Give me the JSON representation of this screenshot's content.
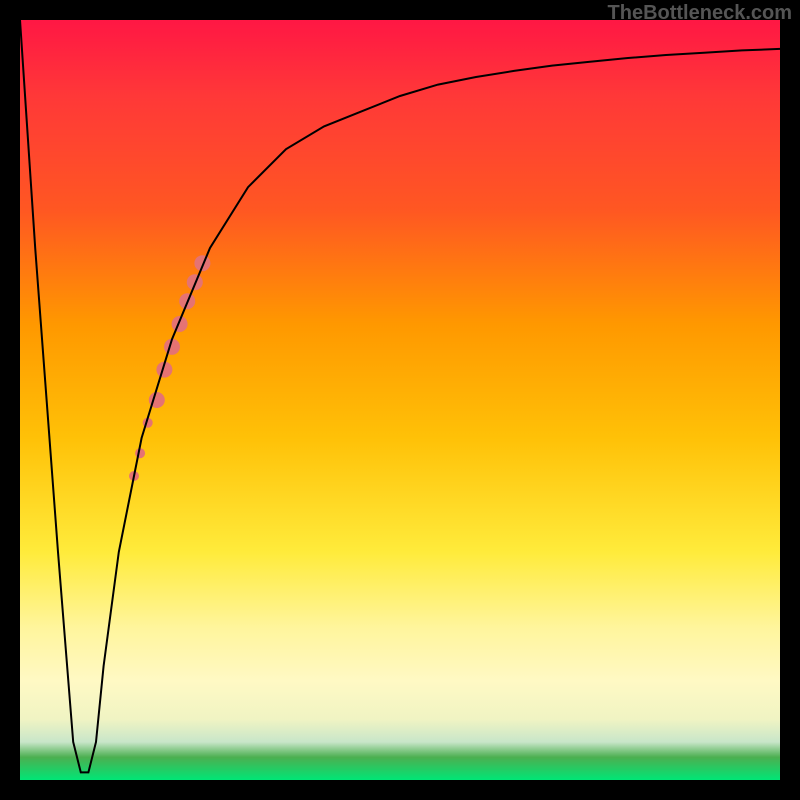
{
  "watermark": "TheBottleneck.com",
  "chart_data": {
    "type": "line",
    "title": "",
    "xlabel": "",
    "ylabel": "",
    "xlim": [
      0,
      100
    ],
    "ylim": [
      0,
      100
    ],
    "background_gradient": {
      "top": "#ff1744",
      "middle": "#ffc107",
      "bottom": "#00e676"
    },
    "series": [
      {
        "name": "bottleneck-curve",
        "color": "#000000",
        "x": [
          0,
          2,
          5,
          7,
          8,
          9,
          10,
          11,
          13,
          16,
          20,
          25,
          30,
          35,
          40,
          45,
          50,
          55,
          60,
          65,
          70,
          75,
          80,
          85,
          90,
          95,
          100
        ],
        "y": [
          100,
          70,
          30,
          5,
          1,
          1,
          5,
          15,
          30,
          45,
          58,
          70,
          78,
          83,
          86,
          88,
          90,
          91.5,
          92.5,
          93.3,
          94,
          94.5,
          95,
          95.4,
          95.7,
          96,
          96.2
        ]
      }
    ],
    "highlight_segment": {
      "name": "highlighted-range",
      "color": "#e57373",
      "points": [
        {
          "x": 15,
          "y": 40,
          "r": 5
        },
        {
          "x": 15.8,
          "y": 43,
          "r": 5
        },
        {
          "x": 16.8,
          "y": 47,
          "r": 5
        },
        {
          "x": 18,
          "y": 50,
          "r": 8
        },
        {
          "x": 19,
          "y": 54,
          "r": 8
        },
        {
          "x": 20,
          "y": 57,
          "r": 8
        },
        {
          "x": 21,
          "y": 60,
          "r": 8
        },
        {
          "x": 22,
          "y": 63,
          "r": 8
        },
        {
          "x": 23,
          "y": 65.5,
          "r": 8
        },
        {
          "x": 24,
          "y": 68,
          "r": 8
        }
      ]
    }
  }
}
